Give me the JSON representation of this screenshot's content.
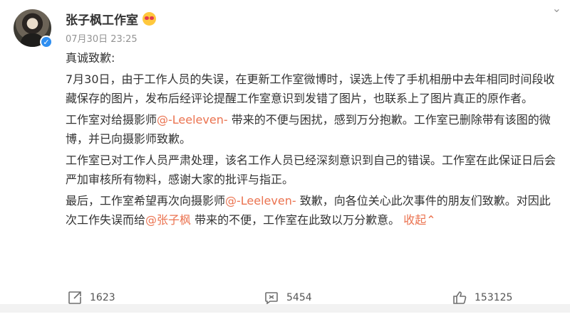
{
  "user": {
    "name": "张子枫工作室",
    "time": "07月30日 23:25"
  },
  "post": {
    "title_line": "真诚致歉:",
    "p1": "7月30日，由于工作人员的失误，在更新工作室微博时，误选上传了手机相册中去年相同时间段收藏保存的图片，发布后经评论提醒工作室意识到发错了图片，也联系上了图片真正的原作者。",
    "p2_a": "工作室对给摄影师",
    "p2_mention": "@-Leeleven-",
    "p2_b": " 带来的不便与困扰，感到万分抱歉。工作室已删除带有该图的微博，并已向摄影师致歉。",
    "p3": "工作室已对工作人员严肃处理，该名工作人员已经深刻意识到自己的错误。工作室在此保证日后会严加审核所有物料，感谢大家的批评与指正。",
    "p4_a": "最后，工作室希望再次向摄影师",
    "p4_mention1": "@-Leeleven-",
    "p4_b": " 致歉，向各位关心此次事件的朋友们致歉。对因此次工作失误而给",
    "p4_mention2": "@张子枫",
    "p4_c": " 带来的不便，工作室在此致以万分歉意。 ",
    "collapse_label": "收起",
    "collapse_glyph": "⌃"
  },
  "actions": {
    "repost": "1623",
    "comment": "5454",
    "like": "153125"
  },
  "more_glyph": "⌄"
}
